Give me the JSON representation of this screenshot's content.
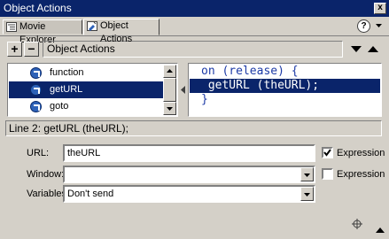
{
  "window": {
    "title": "Object Actions",
    "close_glyph": "x"
  },
  "tabs": [
    {
      "label": "Movie Explorer",
      "icon": "movie-explorer-icon",
      "active": false
    },
    {
      "label": "Object Actions",
      "icon": "object-actions-icon",
      "active": true
    }
  ],
  "header": {
    "help_glyph": "?",
    "menu_icon": "panel-menu-arrow-icon"
  },
  "toolbar": {
    "add_glyph": "+",
    "remove_glyph": "−",
    "breadcrumb": "Object Actions",
    "move_up_icon": "triangle-down-icon",
    "move_down_icon": "triangle-up-icon"
  },
  "actions_list": {
    "items": [
      {
        "label": "function",
        "selected": false
      },
      {
        "label": "getURL",
        "selected": true
      },
      {
        "label": "goto",
        "selected": false
      }
    ]
  },
  "code": {
    "lines": [
      {
        "text": "on (release) {",
        "selected": false
      },
      {
        "text": " getURL (theURL);",
        "selected": true
      },
      {
        "text": "}",
        "selected": false
      }
    ]
  },
  "status_text": "Line 2: getURL (theURL);",
  "params": {
    "url": {
      "label": "URL:",
      "value": "theURL",
      "expression_checked": true,
      "expression_label": "Expression"
    },
    "window": {
      "label": "Window:",
      "value": "",
      "expression_checked": false,
      "expression_label": "Expression"
    },
    "variables": {
      "label": "Variables:",
      "value": "Don't send"
    }
  },
  "colors": {
    "titlebar": "#0a246a",
    "selection": "#0a246a",
    "code_text": "#1c3aa6",
    "face": "#d4d0c8"
  }
}
